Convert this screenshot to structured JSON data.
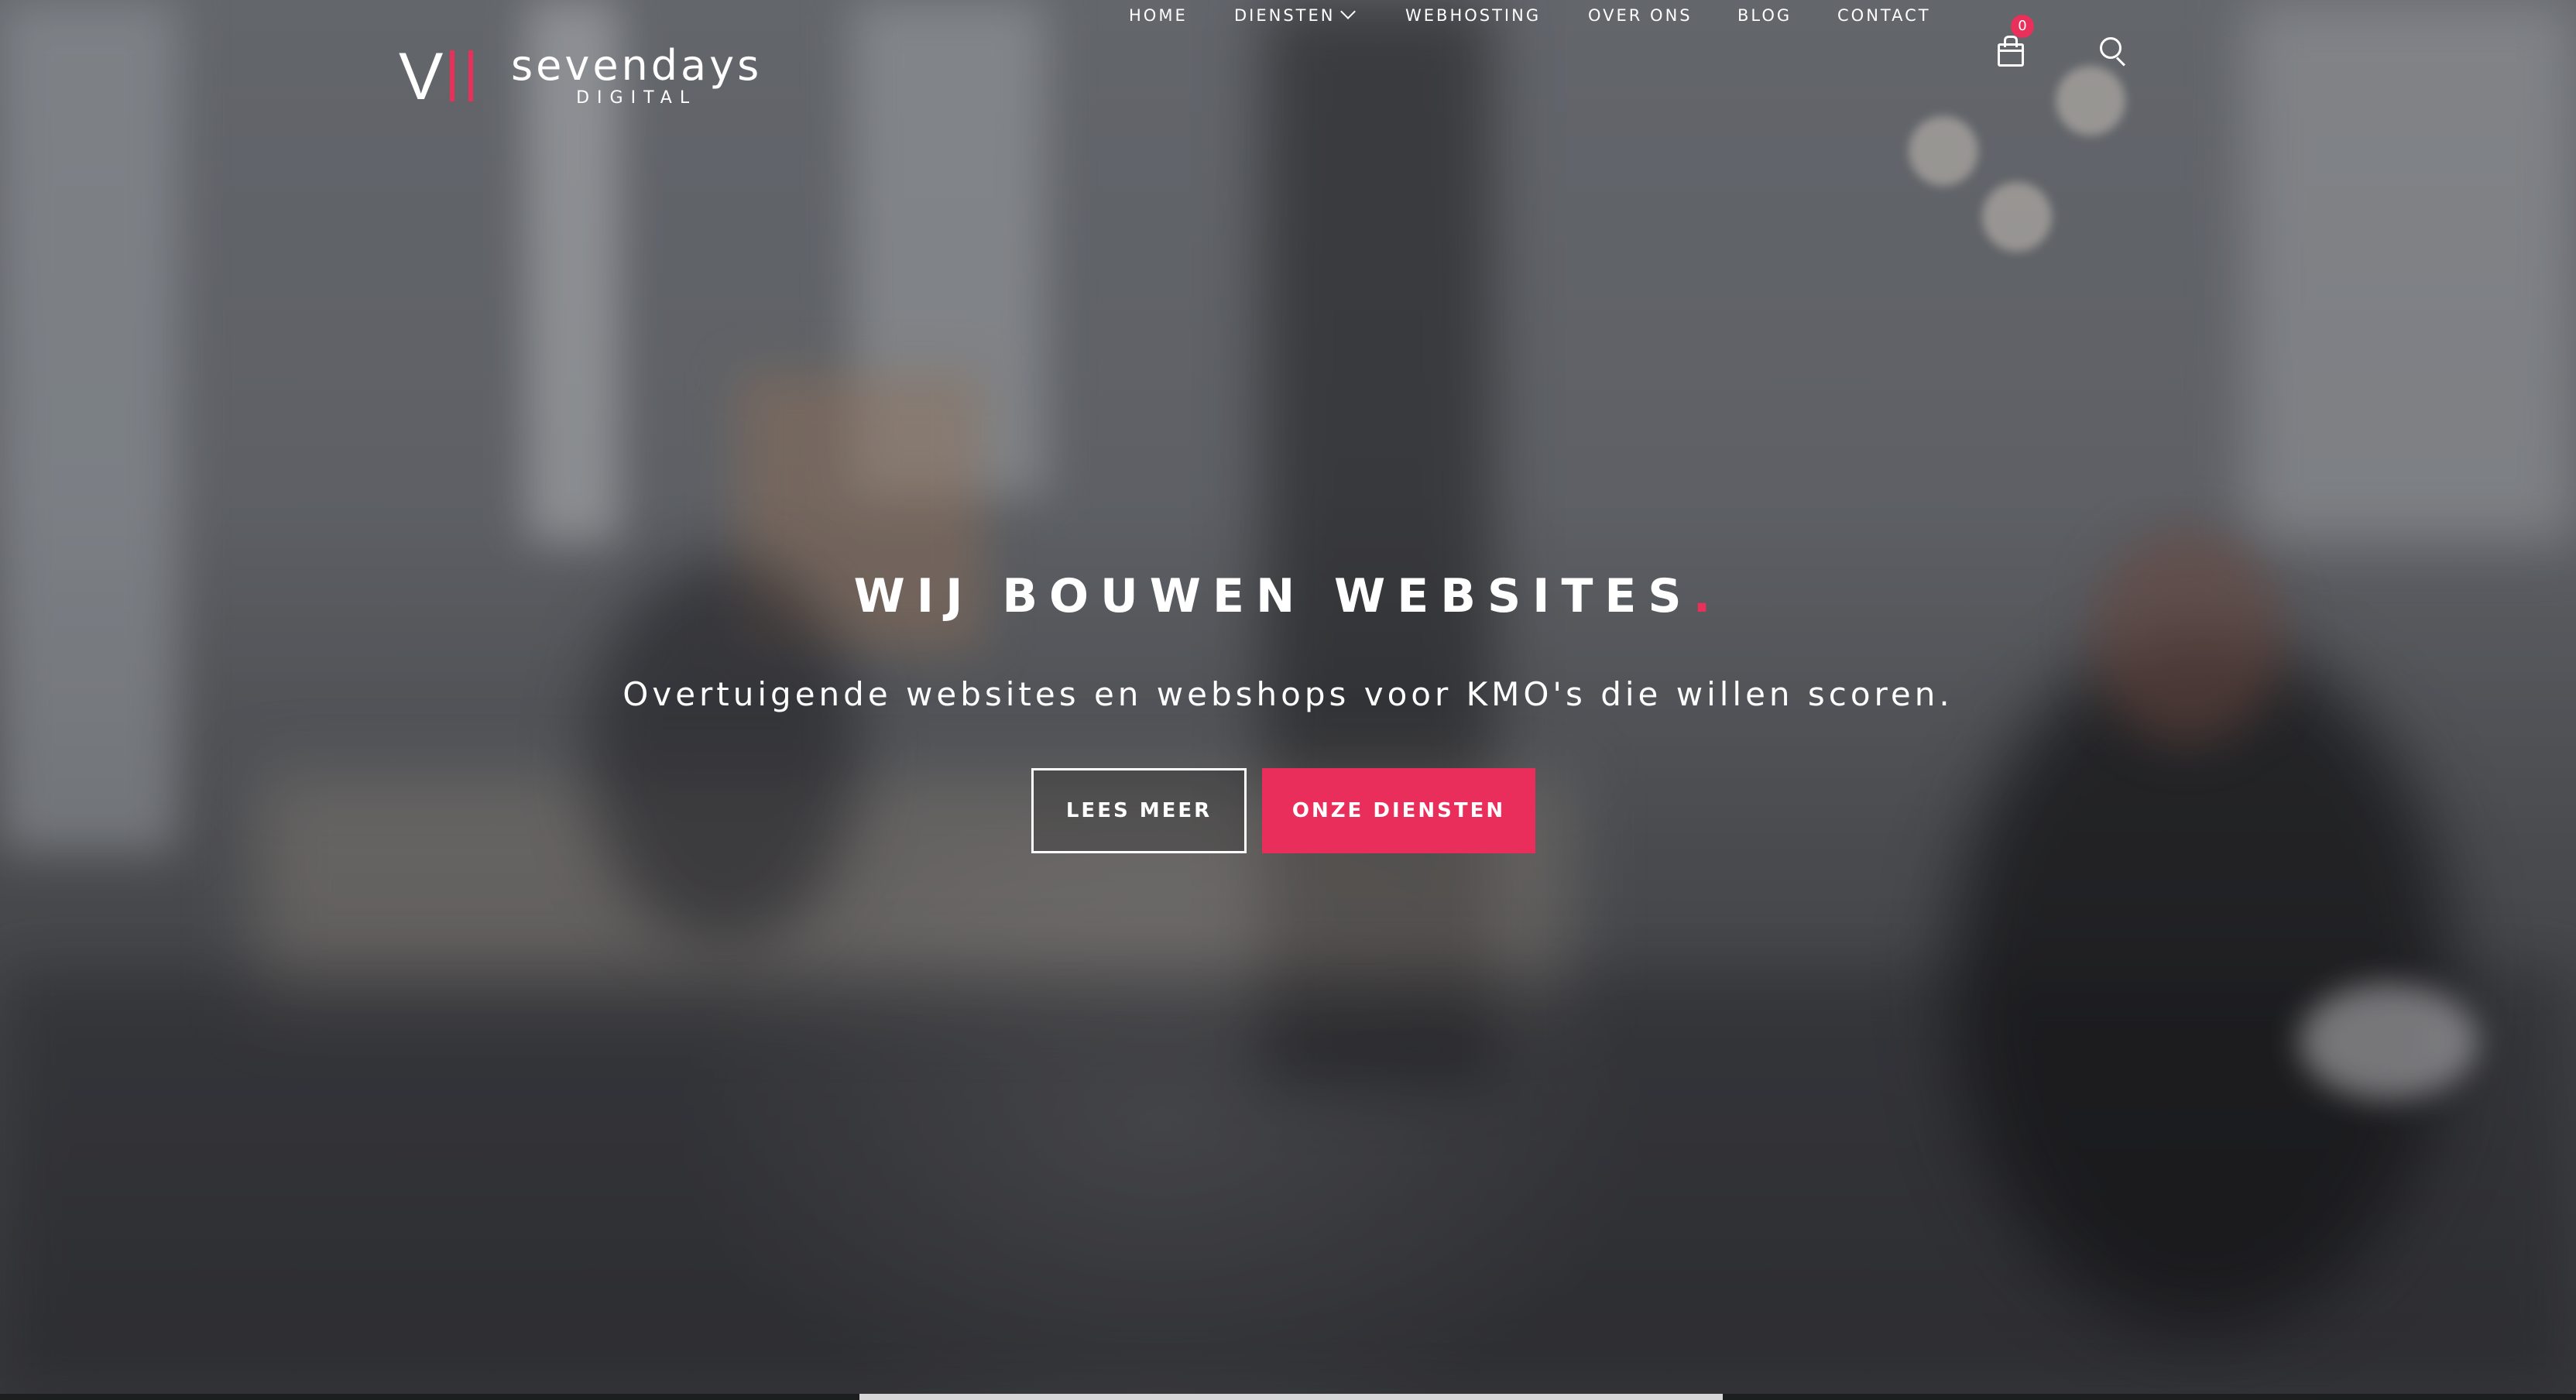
{
  "brand": {
    "logo_mark": "V",
    "name": "sevendays",
    "tagline": "DIGITAL",
    "accent_color": "#e8305a"
  },
  "nav": {
    "items": [
      {
        "label": "HOME"
      },
      {
        "label": "DIENSTEN",
        "has_dropdown": true
      },
      {
        "label": "WEBHOSTING"
      },
      {
        "label": "OVER ONS"
      },
      {
        "label": "BLOG"
      },
      {
        "label": "CONTACT"
      }
    ],
    "cart_icon": "shopping-bag-icon",
    "cart_count": "0",
    "search_icon": "search-icon"
  },
  "hero": {
    "headline": "WIJ BOUWEN WEBSITES",
    "headline_dot": ".",
    "subheadline": "Overtuigende websites en webshops voor KMO's die willen scoren.",
    "buttons": {
      "primary_outline": "LEES MEER",
      "primary_solid": "ONZE DIENSTEN"
    }
  }
}
